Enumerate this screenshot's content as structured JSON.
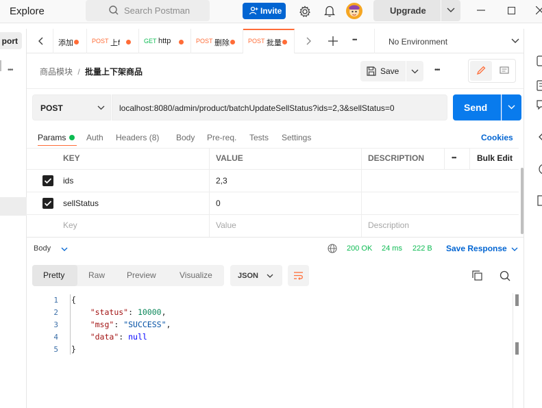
{
  "topbar": {
    "explore": "Explore",
    "search_placeholder": "Search Postman",
    "invite_label": "Invite",
    "upgrade_label": "Upgrade"
  },
  "leftrail": {
    "import_label": "port"
  },
  "tabs": [
    {
      "method": "",
      "name": "添加",
      "method_color": "#ff6c37"
    },
    {
      "method": "POST",
      "name": "上f",
      "method_color": "#ff6c37"
    },
    {
      "method": "GET",
      "name": "http",
      "method_color": "#0cbb52"
    },
    {
      "method": "POST",
      "name": "删除",
      "method_color": "#ff6c37"
    },
    {
      "method": "POST",
      "name": "批量",
      "method_color": "#ff6c37",
      "active": true
    }
  ],
  "environment": "No Environment",
  "breadcrumb": {
    "parent": "商品模块",
    "separator": "/",
    "current": "批量上下架商品"
  },
  "save_label": "Save",
  "request": {
    "method": "POST",
    "url": "localhost:8080/admin/product/batchUpdateSellStatus?ids=2,3&sellStatus=0",
    "send_label": "Send"
  },
  "request_tabs": {
    "params": "Params",
    "auth": "Auth",
    "headers": "Headers (8)",
    "body": "Body",
    "prereq": "Pre-req.",
    "tests": "Tests",
    "settings": "Settings",
    "cookies": "Cookies"
  },
  "params_table": {
    "headers": {
      "key": "KEY",
      "value": "VALUE",
      "description": "DESCRIPTION",
      "more": "•••",
      "bulk_edit": "Bulk Edit"
    },
    "rows": [
      {
        "key": "ids",
        "value": "2,3",
        "checked": true
      },
      {
        "key": "sellStatus",
        "value": "0",
        "checked": true
      }
    ],
    "placeholders": {
      "key": "Key",
      "value": "Value",
      "description": "Description"
    }
  },
  "response": {
    "body_label": "Body",
    "status": "200 OK",
    "time": "24 ms",
    "size": "222 B",
    "save_response": "Save Response",
    "view_tabs": [
      "Pretty",
      "Raw",
      "Preview",
      "Visualize"
    ],
    "format": "JSON",
    "line_numbers": [
      "1",
      "2",
      "3",
      "4",
      "5"
    ],
    "lines": [
      {
        "text": "{"
      },
      {
        "key": "\"status\"",
        "sep": ": ",
        "value": "10000",
        "tail": ","
      },
      {
        "key": "\"msg\"",
        "sep": ": ",
        "value": "\"SUCCESS\"",
        "tail": ","
      },
      {
        "key": "\"data\"",
        "sep": ": ",
        "value": "null",
        "tail": ""
      },
      {
        "text": "}"
      }
    ]
  },
  "colors": {
    "accent": "#ff6c37",
    "primary": "#097bed",
    "success": "#0cbb52"
  }
}
